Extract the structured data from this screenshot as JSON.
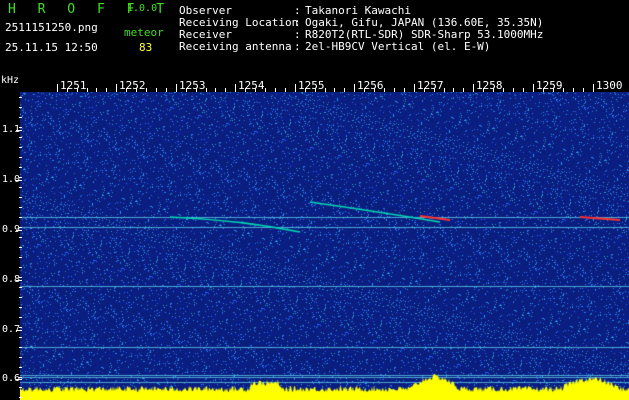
{
  "header": {
    "app_name": "H R O F F T",
    "version": "1.0.0",
    "filename": "2511151250.png",
    "datetime": "25.11.15 12:50",
    "meteor_label": "meteor",
    "meteor_count": "83"
  },
  "info": [
    {
      "label": "Observer",
      "value": "Takanori Kawachi"
    },
    {
      "label": "Receiving Location",
      "value": "Ogaki, Gifu, JAPAN (136.60E, 35.35N)"
    },
    {
      "label": "Receiver",
      "value": "R820T2(RTL-SDR) SDR-Sharp 53.1000MHz"
    },
    {
      "label": "Receiving antenna",
      "value": "2el-HB9CV Vertical (el. E-W)"
    }
  ],
  "axes": {
    "y_unit": "kHz",
    "y_ticks": [
      "1.1",
      "1.0",
      "0.9",
      "0.8",
      "0.7",
      "0.6"
    ],
    "x_ticks": [
      "1251",
      "1252",
      "1253",
      "1254",
      "1255",
      "1256",
      "1257",
      "1258",
      "1259",
      "1300"
    ]
  },
  "colors": {
    "background": "#0a1e6e",
    "logo": "#40e020",
    "meteor_count": "#ffff40",
    "text": "#ffffff",
    "signal": "#00d8b0",
    "level_fill": "#ffff00",
    "strong_signal": "#ff3030"
  }
}
